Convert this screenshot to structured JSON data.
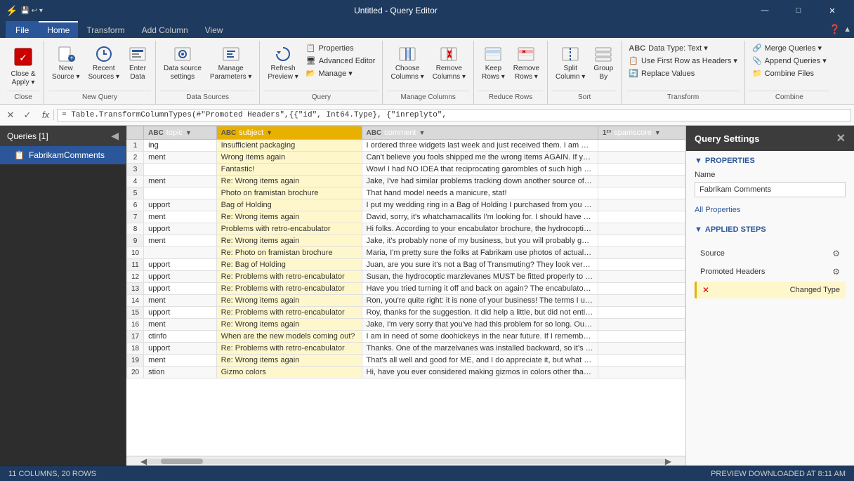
{
  "titlebar": {
    "app_icon": "⚡",
    "title": "Untitled - Query Editor",
    "minimize": "—",
    "maximize": "□",
    "close": "✕"
  },
  "ribbon_tabs": [
    {
      "label": "File",
      "class": "file"
    },
    {
      "label": "Home",
      "class": "active"
    },
    {
      "label": "Transform",
      "class": ""
    },
    {
      "label": "Add Column",
      "class": ""
    },
    {
      "label": "View",
      "class": ""
    }
  ],
  "ribbon": {
    "groups": [
      {
        "label": "Close",
        "buttons": [
          {
            "icon": "💾",
            "label": "Close &\nApply ▾",
            "size": "large"
          }
        ]
      },
      {
        "label": "New Query",
        "buttons": [
          {
            "icon": "📄",
            "label": "New\nSource ▾"
          },
          {
            "icon": "🕐",
            "label": "Recent\nSources ▾"
          },
          {
            "icon": "📊",
            "label": "Enter\nData"
          }
        ]
      },
      {
        "label": "Data Sources",
        "buttons": [
          {
            "icon": "⚙",
            "label": "Data source\nsettings"
          },
          {
            "icon": "🔧",
            "label": "Manage\nParameters ▾"
          }
        ]
      },
      {
        "label": "Query",
        "buttons": [
          {
            "icon": "🔄",
            "label": "Refresh\nPreview ▾"
          },
          {
            "icon": "✏",
            "label": "Properties"
          },
          {
            "icon": "🖥",
            "label": "Advanced Editor"
          },
          {
            "icon": "📋",
            "label": "Manage ▾"
          }
        ]
      },
      {
        "label": "Manage Columns",
        "buttons": [
          {
            "icon": "📌",
            "label": "Choose\nColumns ▾"
          },
          {
            "icon": "🗑",
            "label": "Remove\nColumns ▾"
          },
          {
            "icon": "➡",
            "label": "Keep\nRows ▾"
          },
          {
            "icon": "🗑",
            "label": "Remove\nRows ▾"
          }
        ]
      },
      {
        "label": "Reduce Rows",
        "buttons": [
          {
            "icon": "✂",
            "label": "Split\nColumn ▾"
          },
          {
            "icon": "🔤",
            "label": "Group\nBy"
          }
        ]
      },
      {
        "label": "Sort",
        "buttons": [
          {
            "icon": "🔀",
            "label": ""
          },
          {
            "icon": "↕",
            "label": ""
          }
        ]
      },
      {
        "label": "Transform",
        "small_buttons": [
          {
            "icon": "📝",
            "label": "Data Type: Text ▾"
          },
          {
            "icon": "📋",
            "label": "Use First Row as Headers ▾"
          },
          {
            "icon": "🔄",
            "label": "Replace Values"
          }
        ]
      },
      {
        "label": "Combine",
        "small_buttons": [
          {
            "icon": "🔗",
            "label": "Merge Queries ▾"
          },
          {
            "icon": "📎",
            "label": "Append Queries ▾"
          },
          {
            "icon": "📁",
            "label": "Combine Files"
          }
        ]
      }
    ]
  },
  "formula_bar": {
    "cancel_label": "✕",
    "confirm_label": "✓",
    "fx_label": "fx",
    "formula": "= Table.TransformColumnTypes(#\"Promoted Headers\",{{\"id\", Int64.Type}, {\"inreplyto\","
  },
  "queries_panel": {
    "header": "Queries [1]",
    "collapse_icon": "◀",
    "items": [
      {
        "label": "FabrikamComments",
        "icon": "📋",
        "selected": true
      }
    ]
  },
  "table": {
    "columns": [
      {
        "name": "topic",
        "type": "ABC",
        "selected": false
      },
      {
        "name": "subject",
        "type": "ABC",
        "selected": true
      },
      {
        "name": "comment",
        "type": "ABC",
        "selected": false
      },
      {
        "name": "spamscore",
        "type": "123",
        "selected": false
      }
    ],
    "rows": [
      [
        1,
        "ing",
        "Insufficient packaging",
        "I ordered three widgets last week and just received them. I am VERY di..."
      ],
      [
        2,
        "ment",
        "Wrong items again",
        "Can't believe you fools shipped me the wrong items AGAIN. If you wer..."
      ],
      [
        3,
        "",
        "Fantastic!",
        "Wow! I had NO IDEA that reciprocating garombles of such high quality ..."
      ],
      [
        4,
        "ment",
        "Re: Wrong items again",
        "Jake, I've had similar problems tracking down another source of thinga..."
      ],
      [
        5,
        "",
        "Photo on framistan brochure",
        "That hand model needs a manicure, stat!"
      ],
      [
        6,
        "upport",
        "Bag of Holding",
        "I put my wedding ring in a Bag of Holding I purchased from you guys (f..."
      ],
      [
        7,
        "ment",
        "Re: Wrong items again",
        "David, sorry, it's whatchamacallits I'm looking for. I should have been ..."
      ],
      [
        8,
        "upport",
        "Problems with retro-encabulator",
        "Hi folks. According to your encabulator brochure, the hydrocoptic mar..."
      ],
      [
        9,
        "ment",
        "Re: Wrong items again",
        "Jake, it's probably none of my business, but you will probably get a bet..."
      ],
      [
        10,
        "",
        "Re: Photo on framistan brochure",
        "Maria, I'm pretty sure the folks at Fabrikam use photos of actual custo..."
      ],
      [
        11,
        "upport",
        "Re: Bag of Holding",
        "Juan, are you sure it's not a Bag of Transmuting? They look very simila..."
      ],
      [
        12,
        "upport",
        "Re: Problems with retro-encabulator",
        "Susan, the hydrocoptic marzlevanes MUST be fitted properly to the a..."
      ],
      [
        13,
        "upport",
        "Re: Problems with retro-encabulator",
        "Have you tried turning it off and back on again? The encabulator runs ..."
      ],
      [
        14,
        "ment",
        "Re: Wrong items again",
        "Ron, you're quite right: it is none of your business! The terms I used ar..."
      ],
      [
        15,
        "upport",
        "Re: Problems with retro-encabulator",
        "Roy, thanks for the suggestion. It did help a little, but did not entirely e..."
      ],
      [
        16,
        "ment",
        "Re: Wrong items again",
        "Jake, I'm very sorry that you've had this problem for so long. Our syste..."
      ],
      [
        17,
        "ctinfo",
        "When are the new models coming out?",
        "I am in need of some doohickeys in the near future. If I remember corr..."
      ],
      [
        18,
        "upport",
        "Re: Problems with retro-encabulator",
        "Thanks. One of the marzelvanes was installed backward, so it's my faul..."
      ],
      [
        19,
        "ment",
        "Re: Wrong items again",
        "That's all well and good for ME, and I do appreciate it, but what about ..."
      ],
      [
        20,
        "stion",
        "Gizmo colors",
        "Hi, have you ever considered making gizmos in colors other than chart..."
      ]
    ]
  },
  "settings_panel": {
    "header": "Query Settings",
    "close_icon": "✕",
    "properties_label": "PROPERTIES",
    "name_label": "Name",
    "name_value": "Fabrikam Comments",
    "all_properties_link": "All Properties",
    "applied_steps_label": "APPLIED STEPS",
    "steps": [
      {
        "label": "Source",
        "gear": true,
        "selected": false,
        "error": false
      },
      {
        "label": "Promoted Headers",
        "gear": true,
        "selected": false,
        "error": false
      },
      {
        "label": "Changed Type",
        "gear": false,
        "selected": true,
        "error": true
      }
    ]
  },
  "status_bar": {
    "left": "11 COLUMNS, 20 ROWS",
    "right": "PREVIEW DOWNLOADED AT 8:11 AM"
  }
}
